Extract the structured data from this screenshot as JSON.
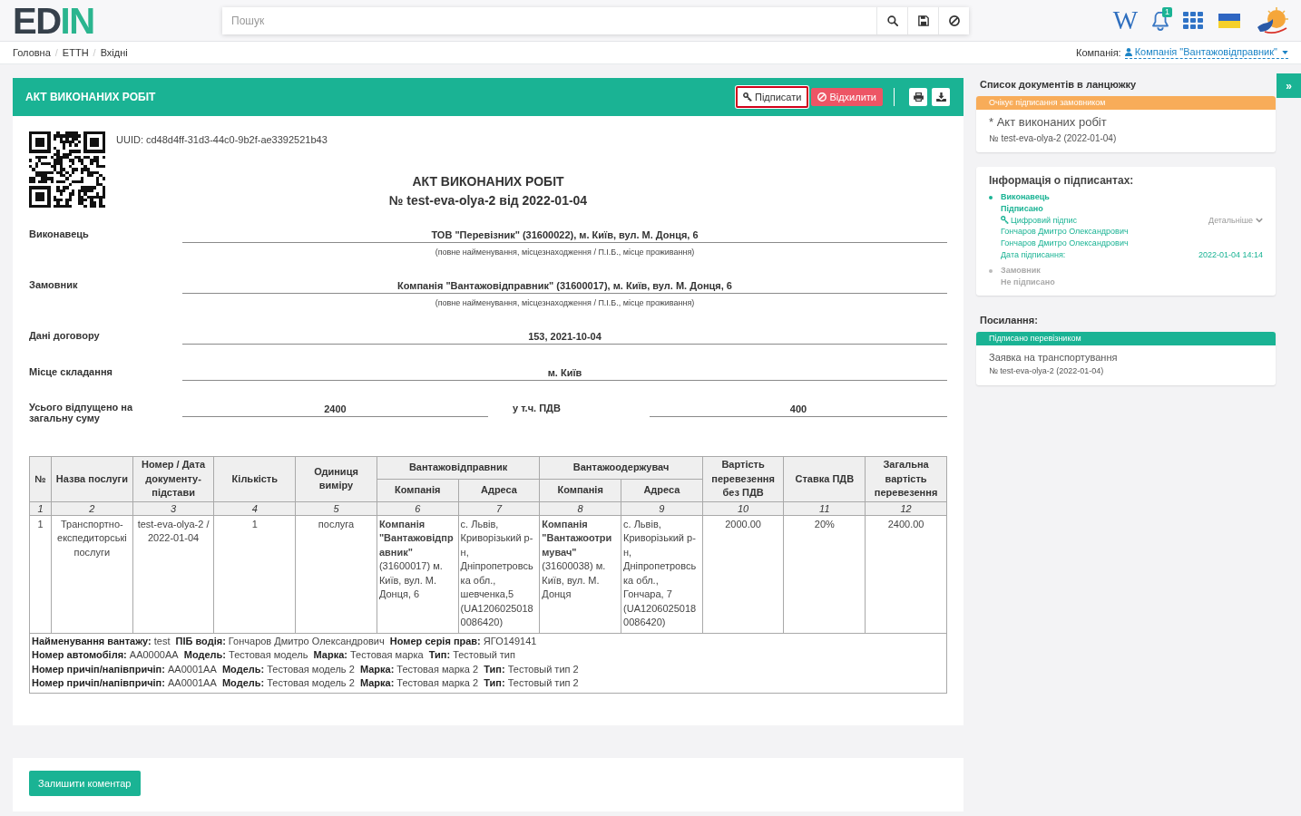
{
  "header": {
    "logo": "EDIN",
    "search": {
      "placeholder": "Пошук"
    },
    "wiki_link": "W",
    "notifications": {
      "count": "1"
    }
  },
  "breadcrumbs": {
    "separator": "/",
    "items": [
      {
        "label": "Головна"
      },
      {
        "label": "ЕТТН"
      },
      {
        "label": "Вхідні"
      }
    ]
  },
  "company_selector": {
    "label": "Компанія:",
    "value": "Компанія \"Вантажовідправник\""
  },
  "document": {
    "title": "АКТ ВИКОНАНИХ РОБІТ",
    "actions": [
      {
        "label": "Підписати",
        "kind": "sign",
        "highlighted": true
      },
      {
        "label": "Відхилити",
        "kind": "reject",
        "highlighted": false
      }
    ],
    "uuid": "UUID: cd48d4ff-31d3-44c0-9b2f-ae3392521b43",
    "heading": "АКТ ВИКОНАНИХ РОБІТ",
    "number": "№ test-eva-olya-2 від 2022-01-04",
    "fields": [
      {
        "label": "Виконавець",
        "value": "ТОВ \"Перевізник\" (31600022), м. Київ, вул. М. Донця, 6",
        "hint": "(повне найменування, місцезнаходження / П.І.Б., місце проживання)"
      },
      {
        "label": "Замовник",
        "value": "Компанія \"Вантажовідправник\" (31600017), м. Київ, вул. М. Донця, 6",
        "hint": "(повне найменування, місцезнаходження / П.І.Б., місце проживання)"
      },
      {
        "label": "Дані договору",
        "value": "153, 2021-10-04"
      },
      {
        "label": "Місце складання",
        "value": "м. Київ"
      }
    ],
    "totals": {
      "label": "Усього відпущено на загальну суму",
      "value": "2400",
      "vat_label": "у т.ч. ПДВ",
      "vat_value": "400"
    },
    "table": {
      "header_rows": [
        [
          {
            "label": "№",
            "rowspan": 2
          },
          {
            "label": "Назва послуги",
            "rowspan": 2
          },
          {
            "label": "Номер / Дата документу-підстави",
            "rowspan": 2
          },
          {
            "label": "Кількість",
            "rowspan": 2
          },
          {
            "label": "Одиниця виміру",
            "rowspan": 2
          },
          {
            "label": "Вантажовідправник",
            "colspan": 2
          },
          {
            "label": "Вантажоодержувач",
            "colspan": 2
          },
          {
            "label": "Вартість перевезення без ПДВ",
            "rowspan": 2
          },
          {
            "label": "Ставка ПДВ",
            "rowspan": 2
          },
          {
            "label": "Загальна вартість перевезення",
            "rowspan": 2
          }
        ],
        [
          {
            "label": "Компанія"
          },
          {
            "label": "Адреса"
          },
          {
            "label": "Компанія"
          },
          {
            "label": "Адреса"
          }
        ]
      ],
      "column_numbers": [
        "1",
        "2",
        "3",
        "4",
        "5",
        "6",
        "7",
        "8",
        "9",
        "10",
        "11",
        "12"
      ],
      "rows": [
        [
          "1",
          "Транспортно-експедиторські послуги",
          "test-eva-olya-2 / 2022-01-04",
          "1",
          "послуга",
          "**Компанія \"Вантажовідправник\"** (31600017) м. Київ, вул. М. Донця, 6",
          "с. Львів, Криворізький р-н, Дніпропетровська обл., шевченка,5 (UA12060250180086420)",
          "**Компанія \"Вантажоотримувач\"** (31600038) м. Київ, вул. М. Донця",
          "с. Львів, Криворізький р-н, Дніпропетровська обл., Гончара, 7 (UA12060250180086420)",
          "2000.00",
          "20%",
          "2400.00"
        ]
      ],
      "notes": [
        "**Найменування вантажу:** test  **ПІБ водія:** Гончаров Дмитро Олександрович  **Номер серія прав:** ЯГО149141",
        "**Номер автомобіля:** АА0000АА  **Модель:** Тестовая модель  **Марка:** Тестовая марка  **Тип:** Тестовый тип",
        "**Номер причіп/напівпричіп:** АА0001АА  **Модель:** Тестовая модель 2  **Марка:** Тестовая марка 2  **Тип:** Тестовый тип 2",
        "**Номер причіп/напівпричіп:** АА0001АА  **Модель:** Тестовая модель 2  **Марка:** Тестовая марка 2  **Тип:** Тестовый тип 2"
      ]
    },
    "comment_button": "Залишити коментар"
  },
  "chain": {
    "title": "Список документів в ланцюжку",
    "documents": [
      {
        "status": "Очікує підписання замовником",
        "kind": "pending",
        "name": "* Акт виконаних робіт",
        "number": "№ test-eva-olya-2 (2022-01-04)"
      }
    ]
  },
  "signers": {
    "title": "Інформація о підписантах:",
    "items": [
      {
        "role": "Виконавець",
        "status": "Підписано",
        "signed": true,
        "signature": "Цифровий підпис",
        "details": "Детальніше",
        "names": [
          "Гончаров Дмитро Олександрович",
          "Гончаров Дмитро Олександрович"
        ],
        "date_label": "Дата підписання:",
        "date": "2022-01-04 14:14"
      },
      {
        "role": "Замовник",
        "status": "Не підписано",
        "signed": false
      }
    ]
  },
  "links": {
    "title": "Посилання:",
    "documents": [
      {
        "status": "Підписано перевізником",
        "kind": "signed",
        "name": "Заявка на транспортування",
        "number": "№ test-eva-olya-2 (2022-01-04)"
      }
    ]
  },
  "panel_toggle": "»"
}
